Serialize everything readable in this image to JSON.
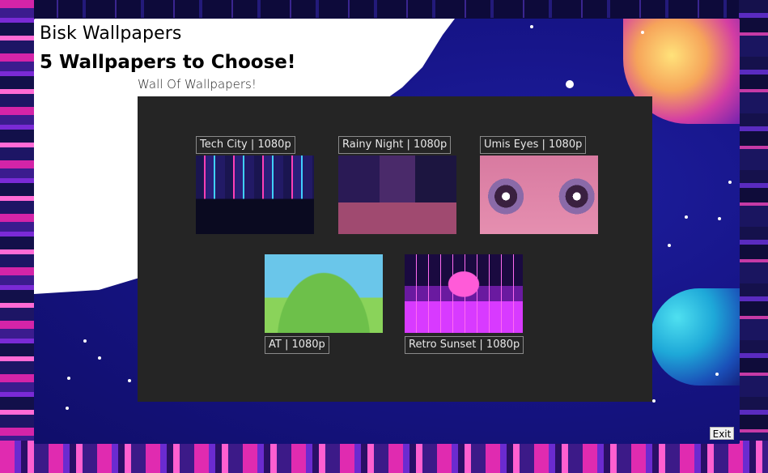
{
  "app": {
    "title": "Bisk Wallpapers",
    "subtitle": "5 Wallpapers to Choose!",
    "section_label": "Wall Of Wallpapers!"
  },
  "wallpapers": [
    {
      "label": "Tech City | 1080p",
      "theme": "neon cyberpunk city at night"
    },
    {
      "label": "Rainy Night | 1080p",
      "theme": "cozy bedroom on a rainy night"
    },
    {
      "label": "Umis Eyes | 1080p",
      "theme": "close-up of anime eyes"
    },
    {
      "label": "AT | 1080p",
      "theme": "cartoon characters in a green field"
    },
    {
      "label": "Retro Sunset | 1080p",
      "theme": "synthwave retro sunset grid"
    }
  ],
  "controls": {
    "exit_label": "Exit"
  },
  "colors": {
    "gallery_background": "#252525",
    "label_border": "#8a8a8a",
    "label_text": "#e8e8e8",
    "window_header": "#ffffff"
  }
}
